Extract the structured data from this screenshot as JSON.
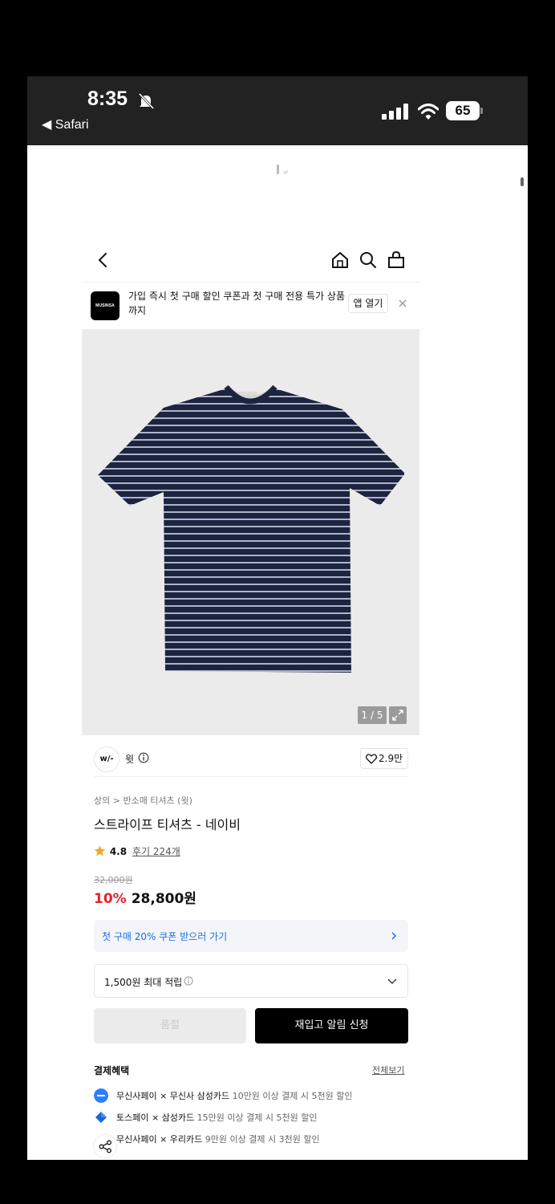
{
  "status": {
    "time": "8:35",
    "back_app": "◀ Safari",
    "battery": "65"
  },
  "banner": {
    "logo": "MUSINSA",
    "text": "가입 즉시 첫 구매 할인 쿠폰과 첫 구매 전용 특가 상품까지",
    "open_label": "앱 열기"
  },
  "gallery": {
    "counter": "1 / 5"
  },
  "brand": {
    "logo": "w/-",
    "name": "윗",
    "likes": "2.9만"
  },
  "product": {
    "breadcrumb": "상의 > 반소매 티셔츠 (윗)",
    "title": "스트라이프 티셔츠 - 네이비",
    "rating": "4.8",
    "reviews": "후기 224개",
    "original_price": "32,000원",
    "discount": "10%",
    "price": "28,800원"
  },
  "coupon": {
    "label": "첫 구매 20% 쿠폰 받으러 가기"
  },
  "points": {
    "label": "1,500원 최대 적립"
  },
  "actions": {
    "size_label": "품절",
    "restock_label": "재입고 알림 신청"
  },
  "payment": {
    "heading": "결제혜택",
    "view_all": "전체보기",
    "rows": [
      {
        "name": "무신사페이 × 무신사 삼성카드",
        "detail": "10만원 이상 결제 시 5천원 할인"
      },
      {
        "name": "토스페이 × 삼성카드",
        "detail": "15만원 이상 결제 시 5천원 할인"
      },
      {
        "name": "무신사페이 × 우리카드",
        "detail": "9만원 이상 결제 시 3천원 할인"
      }
    ]
  },
  "colors": {
    "discount_red": "#e5242b",
    "coupon_blue": "#1a6ee6",
    "shirt_navy": "#1f2745",
    "rating_star": "#f5a623"
  },
  "icons": {
    "nav": [
      "back-icon",
      "home-icon",
      "search-icon",
      "bag-icon"
    ],
    "close": "close-icon",
    "share": "share-icon"
  }
}
